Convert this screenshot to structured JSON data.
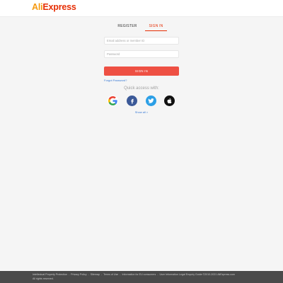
{
  "header": {
    "logo_part1": "Ali",
    "logo_part2": "Express"
  },
  "tabs": {
    "register": "REGISTER",
    "sign_in": "SIGN IN",
    "active": "sign_in"
  },
  "form": {
    "email_placeholder": "Email address or member ID",
    "email_value": "",
    "password_placeholder": "Password",
    "password_value": "",
    "sign_in_button": "SIGN IN",
    "forgot_password": "Forgot Password?"
  },
  "quick_access": {
    "label": "Quick access with:",
    "providers": [
      {
        "name": "Google",
        "icon": "google-icon",
        "color": "#ffffff"
      },
      {
        "name": "Facebook",
        "icon": "facebook-icon",
        "color": "#3b5998"
      },
      {
        "name": "Twitter",
        "icon": "twitter-icon",
        "color": "#2b9fe6"
      },
      {
        "name": "Apple",
        "icon": "apple-icon",
        "color": "#111111"
      }
    ],
    "show_all": "Show all >"
  },
  "footer": {
    "links": [
      "Intellectual Property Protection",
      "Privacy Policy",
      "Sitemap",
      "Terms of Use",
      "Information for EU consumers",
      "User Information Legal Enquiry Guide ©2010-2021 AliExpress.com"
    ],
    "separator": "-",
    "rights": "All rights reserved."
  },
  "colors": {
    "brand_red": "#e62e04",
    "brand_orange": "#f59a10",
    "button": "#ee5043",
    "link": "#3a7bd5",
    "footer_bg": "#4a4a4a"
  }
}
